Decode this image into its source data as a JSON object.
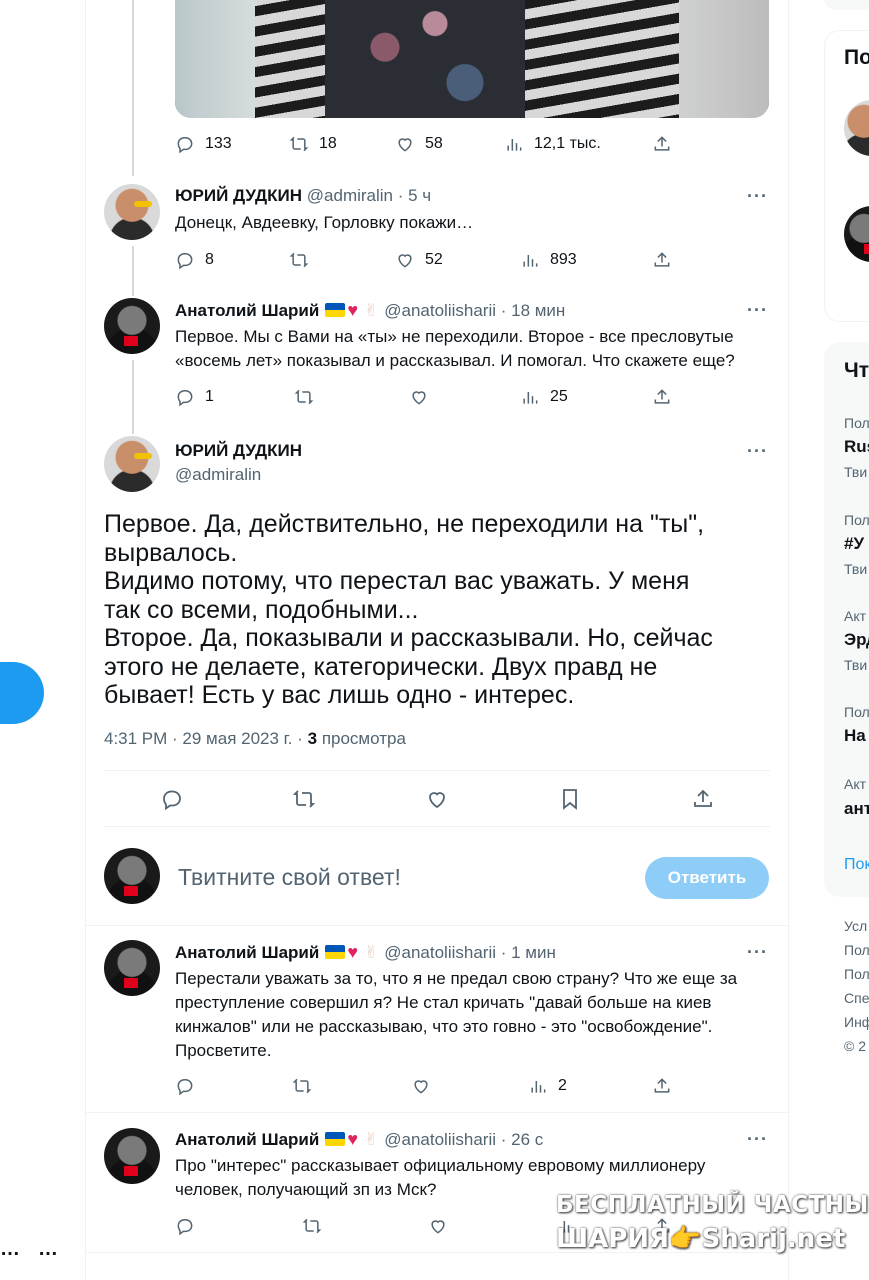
{
  "left_rail": {
    "more_dots_a": "…",
    "more_dots_b": "…"
  },
  "tweet0": {
    "replies": "133",
    "retweets": "18",
    "likes": "58",
    "views": "12,1 тыс."
  },
  "tweet1": {
    "name": "ЮРИЙ ДУДКИН",
    "meta": "@admiralin · 5 ч",
    "text": "Донецк, Авдеевку, Горловку покажи…",
    "replies": "8",
    "retweets": "",
    "likes": "52",
    "views": "893"
  },
  "tweet2": {
    "name": "Анатолий Шарий",
    "meta": "@anatoliisharii · 18 мин",
    "text": "Первое. Мы с Вами на «ты» не переходили. Второе - все пресловутые\n«восемь лет» показывал и рассказывал. И помогал. Что скажете еще?",
    "replies": "1",
    "retweets": "",
    "likes": "",
    "views": "25"
  },
  "main_tweet": {
    "name": "ЮРИЙ ДУДКИН",
    "handle": "@admiralin",
    "text": "Первое. Да, действительно, не переходили на \"ты\",\nвырвалось.\nВидимо потому, что перестал вас уважать. У меня\nтак со всеми, подобными...\nВторое. Да, показывали и рассказывали. Но, сейчас\nэтого не делаете, категорически. Двух правд не\nбывает! Есть у вас лишь одно -  интерес.",
    "time": "4:31 PM · 29 мая 2023 г. · ",
    "views_count": "3",
    "views_label": " просмотра"
  },
  "reply_box": {
    "placeholder": "Твитните свой ответ!",
    "button": "Ответить"
  },
  "tweet3": {
    "name": "Анатолий Шарий",
    "meta": "@anatoliisharii · 1 мин",
    "text": "Перестали уважать за то, что я не предал свою страну? Что же еще за\nпреступление совершил я? Не стал кричать \"давай больше на киев\nкинжалов\" или не рассказываю, что это говно  - это \"освобождение\".\nПросветите.",
    "replies": "",
    "retweets": "",
    "likes": "",
    "views": "2"
  },
  "tweet4": {
    "name": "Анатолий Шарий",
    "meta": "@anatoliisharii · 26 с",
    "text": "Про \"интерес\" рассказывает официальному евровому миллионеру\nчеловек, получающий зп из Мск?"
  },
  "right_column": {
    "card1_title": "По",
    "card2_title": "Чт",
    "trends": [
      {
        "small": "Пол",
        "bold": "Rus",
        "sub": "Тви"
      },
      {
        "small": "Пол",
        "bold": "#У",
        "sub": "Тви"
      },
      {
        "small": "Акт",
        "bold": "Эрд",
        "sub": "Тви"
      },
      {
        "small": "Пол",
        "bold": "На",
        "sub": ""
      },
      {
        "small": "Акт",
        "bold": "ант",
        "sub": ""
      }
    ],
    "show_more": "Пок",
    "footer": [
      "Усл",
      "Пол",
      "Пол",
      "Спе",
      "Инф",
      "© 2"
    ]
  },
  "watermark": {
    "line1": "БЕСПЛАТНЫЙ ЧАСТНЫЙ",
    "line2": "ШАРИЯ👉Sharij.net"
  },
  "colors": {
    "accent": "#1d9bf0",
    "reply_btn_disabled": "#8ecdf8",
    "text_secondary": "#536471",
    "border": "#eff3f4"
  }
}
